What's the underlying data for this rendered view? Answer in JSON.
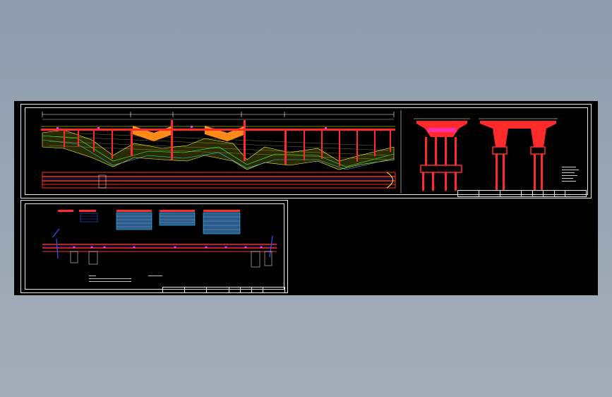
{
  "canvas": {
    "background": "#000000",
    "desktop_top": "#8e9cac",
    "desktop_bottom": "#a4aeb9"
  },
  "colors": {
    "frame": "#e8e8e8",
    "deck": "#ff2a2a",
    "ground": "#ffff33",
    "water": "#33ccff",
    "dim": "#ffffff",
    "green": "#33ff66",
    "orange": "#ff8a1a",
    "magenta": "#ff33ff",
    "blue": "#3355ff"
  },
  "sheets": {
    "elevation_sheet": {
      "icon": "bridge-elevation-drawing",
      "title_block_cells": 8
    },
    "plan_sheet": {
      "icon": "bridge-plan-layout-drawing",
      "title_block_cells": 7,
      "tables": 4
    }
  }
}
